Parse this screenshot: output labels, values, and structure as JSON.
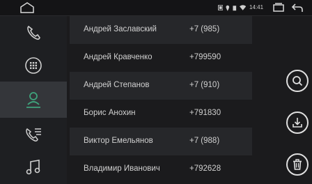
{
  "status_bar": {
    "time": "14:41",
    "icons": [
      "home-outline-icon",
      "bluetooth-icon",
      "location-icon",
      "wifi-icon",
      "recent-apps-icon",
      "back-icon"
    ]
  },
  "sidebar": {
    "items": [
      {
        "icon": "phone-handset-icon",
        "active": false
      },
      {
        "icon": "dialpad-icon",
        "active": false
      },
      {
        "icon": "contacts-icon",
        "active": true
      },
      {
        "icon": "call-log-icon",
        "active": false
      },
      {
        "icon": "music-icon",
        "active": false
      }
    ]
  },
  "contacts": [
    {
      "name": "Андрей Заславский",
      "phone": "+7 (985)"
    },
    {
      "name": "Андрей Кравченко",
      "phone": "+799590"
    },
    {
      "name": "Андрей Степанов",
      "phone": "+7 (910)"
    },
    {
      "name": "Борис Анохин",
      "phone": "+791830"
    },
    {
      "name": "Виктор Емельянов",
      "phone": "+7 (988)"
    },
    {
      "name": "Владимир Иванович",
      "phone": "+792628"
    }
  ],
  "actions": {
    "search": "search-icon",
    "download": "download-icon",
    "delete": "trash-icon"
  },
  "colors": {
    "background": "#1b1b1d",
    "sidebar": "#1e1f22",
    "active_item": "#34363a",
    "accent": "#3fa37c",
    "text": "#d0d0d0"
  }
}
